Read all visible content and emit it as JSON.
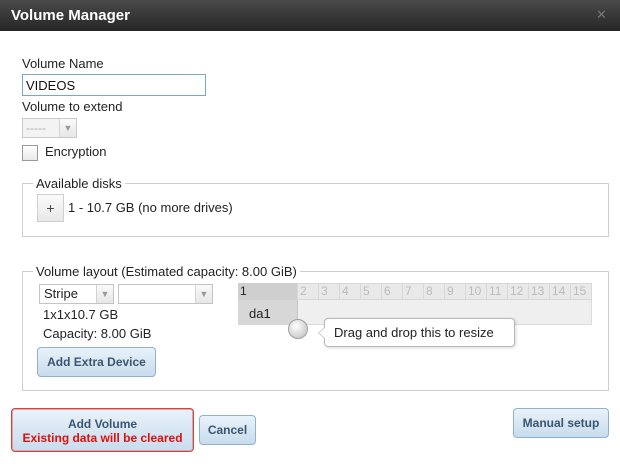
{
  "window": {
    "title": "Volume Manager"
  },
  "form": {
    "volume_name_label": "Volume Name",
    "volume_name_value": "VIDEOS",
    "volume_to_extend_label": "Volume to extend",
    "volume_to_extend_value": "-----",
    "encryption_label": "Encryption",
    "encryption_checked": false
  },
  "available_disks": {
    "legend": "Available disks",
    "add_symbol": "+",
    "disk_text": "1 - 10.7 GB (no more drives)"
  },
  "volume_layout": {
    "legend": "Volume layout (Estimated capacity: 8.00 GiB)",
    "layout_type": "Stripe",
    "second_select_value": "",
    "size_text": "1x1x10.7 GB",
    "capacity_text": "Capacity: 8.00 GiB",
    "add_extra_device_label": "Add Extra Device",
    "grid_columns": [
      "1",
      "2",
      "3",
      "4",
      "5",
      "6",
      "7",
      "8",
      "9",
      "10",
      "11",
      "12",
      "13",
      "14",
      "15"
    ],
    "disk_chip": "da1",
    "tooltip": "Drag and drop this to resize"
  },
  "buttons": {
    "add_volume": "Add Volume",
    "add_volume_warning": "Existing data will be cleared",
    "cancel": "Cancel",
    "manual_setup": "Manual setup"
  },
  "colors": {
    "titlebar": "#333333",
    "warning": "#dd1111",
    "button_text": "#3a5670",
    "button_bg": "#c8dced"
  }
}
